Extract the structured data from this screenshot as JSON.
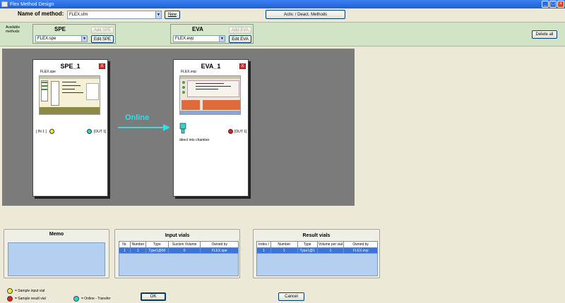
{
  "window": {
    "title": "Flex Method Design",
    "buttons": [
      "_",
      "□",
      "×"
    ]
  },
  "toolbar": {
    "name_label": "Name of method:",
    "method_value": "FLEX.sfm",
    "new_button": "New",
    "activ_button": "Activ. / Deact. Methods"
  },
  "available": {
    "label_line1": "Available",
    "label_line2": "methods:",
    "spe": {
      "title": "SPE",
      "value": "FLEX.spe",
      "add": "Add SPE",
      "edit": "Edit SPE"
    },
    "eva": {
      "title": "EVA",
      "value": "FLEX.evp",
      "add": "Add EVA",
      "edit": "Edit EVA"
    },
    "delete_all": "Delete all"
  },
  "workflow": {
    "spe_card": {
      "title": "SPE_1",
      "file": "FLEX.spe",
      "in_label": "[ IN 1 ]",
      "out_label": "[OUT 1]",
      "close": "X"
    },
    "eva_card": {
      "title": "EVA_1",
      "file": "FLEX.evp",
      "note": "direct into chamber",
      "out_label": "[OUT 1]",
      "close": "X"
    },
    "transfer_label": "Online"
  },
  "memo": {
    "title": "Memo"
  },
  "input_vials": {
    "title": "Input vials",
    "columns": [
      "Nr.",
      "Number",
      "Type",
      "Suction Volume",
      "Owned by"
    ],
    "rows": [
      [
        "1",
        "1",
        "Type1@60",
        "0",
        "FLEX.spe"
      ]
    ]
  },
  "result_vials": {
    "title": "Result vials",
    "columns": [
      "Index /",
      "Number",
      "Type",
      "Volume per vial",
      "Owned by"
    ],
    "rows": [
      [
        "1",
        "1",
        "Type1@1",
        "1",
        "FLEX.evp"
      ]
    ]
  },
  "legend": {
    "input": "= Sample input vial",
    "result": "= Sample result vial",
    "online": "= Online - Transfer"
  },
  "footer": {
    "ok": "OK",
    "cancel": "Cancel"
  },
  "colors": {
    "input_dot": "#f3ee32",
    "result_dot": "#e0201c",
    "online_dot": "#2fd6d0",
    "arrow": "#2de0e6"
  }
}
